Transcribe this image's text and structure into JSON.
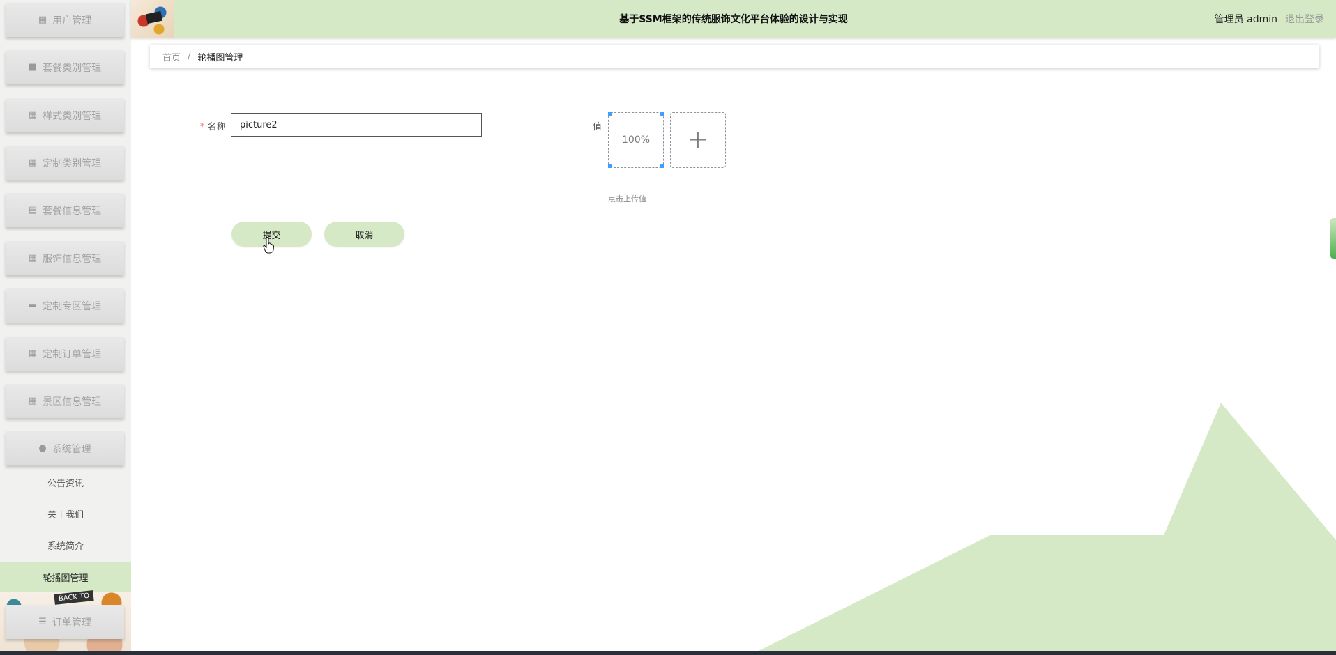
{
  "header": {
    "title": "基于SSM框架的传统服饰文化平台体验的设计与实现",
    "admin_label": "管理员 admin",
    "logout_label": "退出登录"
  },
  "sidebar": {
    "menu": [
      {
        "label": "用户管理",
        "icon": "grid-icon"
      },
      {
        "label": "套餐类别管理",
        "icon": "briefcase-icon"
      },
      {
        "label": "样式类别管理",
        "icon": "grid-icon"
      },
      {
        "label": "定制类别管理",
        "icon": "grid-icon"
      },
      {
        "label": "套餐信息管理",
        "icon": "clipboard-icon"
      },
      {
        "label": "服饰信息管理",
        "icon": "grid-icon"
      },
      {
        "label": "定制专区管理",
        "icon": "monitor-icon"
      },
      {
        "label": "定制订单管理",
        "icon": "grid-icon"
      },
      {
        "label": "景区信息管理",
        "icon": "grid-icon"
      },
      {
        "label": "系统管理",
        "icon": "bulb-icon"
      }
    ],
    "submenu": [
      {
        "label": "公告资讯"
      },
      {
        "label": "关于我们"
      },
      {
        "label": "系统简介"
      },
      {
        "label": "轮播图管理",
        "active": true
      }
    ],
    "bottom_menu": {
      "label": "订单管理",
      "icon": "list-icon"
    },
    "art_tag": "BACK TO"
  },
  "breadcrumb": {
    "home": "首页",
    "separator": "/",
    "current": "轮播图管理"
  },
  "form": {
    "name_label": "名称",
    "required_mark": "*",
    "name_value": "picture2",
    "value_label": "值",
    "preview_text": "100%",
    "upload_hint": "点击上传值",
    "submit_label": "提交",
    "cancel_label": "取消"
  },
  "colors": {
    "accent": "#d5e9c6",
    "header_bg": "#d5e9c6",
    "sidebar_bg": "#f1f2f0",
    "required": "#f56c6c",
    "selection": "#409eff"
  }
}
